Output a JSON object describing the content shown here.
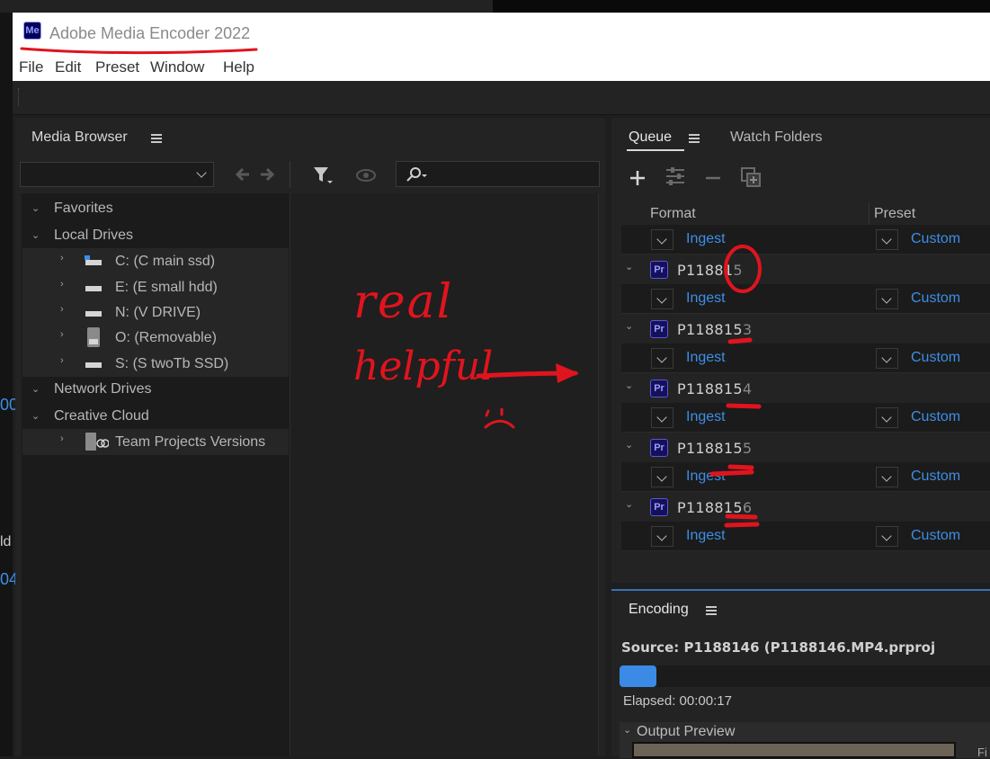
{
  "app": {
    "title": "Adobe Media Encoder 2022",
    "icon_text": "Me"
  },
  "menu": [
    "File",
    "Edit",
    "Preset",
    "Window",
    "Help"
  ],
  "media_browser": {
    "title": "Media Browser",
    "tree": [
      {
        "label": "Favorites",
        "level": 0,
        "expanded": true
      },
      {
        "label": "Local Drives",
        "level": 0,
        "expanded": true
      },
      {
        "label": "C: (C main ssd)",
        "level": 1,
        "icon": "drive-icon"
      },
      {
        "label": "E: (E small hdd)",
        "level": 1,
        "icon": "drive-icon"
      },
      {
        "label": "N: (V DRIVE)",
        "level": 1,
        "icon": "drive-icon"
      },
      {
        "label": "O: (Removable)",
        "level": 1,
        "icon": "removable-drive-icon"
      },
      {
        "label": "S: (S twoTb SSD)",
        "level": 1,
        "icon": "drive-icon"
      },
      {
        "label": "Network Drives",
        "level": 0,
        "expanded": true
      },
      {
        "label": "Creative Cloud",
        "level": 0,
        "expanded": true
      },
      {
        "label": "Team Projects Versions",
        "level": 1,
        "icon": "team-projects-icon"
      }
    ]
  },
  "queue": {
    "tabs": [
      "Queue",
      "Watch Folders"
    ],
    "columns": {
      "format": "Format",
      "preset": "Preset"
    },
    "first_row": {
      "format": "Ingest",
      "preset": "Custom"
    },
    "items": [
      {
        "name": "P11881",
        "suffix": "5",
        "format": "Ingest",
        "preset": "Custom"
      },
      {
        "name": "P118815",
        "suffix": "3",
        "format": "Ingest",
        "preset": "Custom"
      },
      {
        "name": "P118815",
        "suffix": "4",
        "format": "Ingest",
        "preset": "Custom"
      },
      {
        "name": "P118815",
        "suffix": "5",
        "format": "Ingest",
        "preset": "Custom"
      },
      {
        "name": "P118815",
        "suffix": "6",
        "format": "Ingest",
        "preset": "Custom"
      }
    ],
    "item_icon_text": "Pr"
  },
  "encoding": {
    "title": "Encoding",
    "source": "Source: P1188146 (P1188146.MP4.prproj",
    "progress": 0.1,
    "elapsed": "Elapsed: 00:00:17",
    "output_preview": "Output Preview",
    "partial_right_text": "Fi"
  },
  "left_edge_fragments": [
    "00",
    "ld",
    "04"
  ],
  "annotation": {
    "line1": "real",
    "line2": "helpful",
    "color": "#e0141e"
  },
  "colors": {
    "accent": "#3d8ee6",
    "panel": "#232323",
    "progress": "#3a8ae6"
  }
}
